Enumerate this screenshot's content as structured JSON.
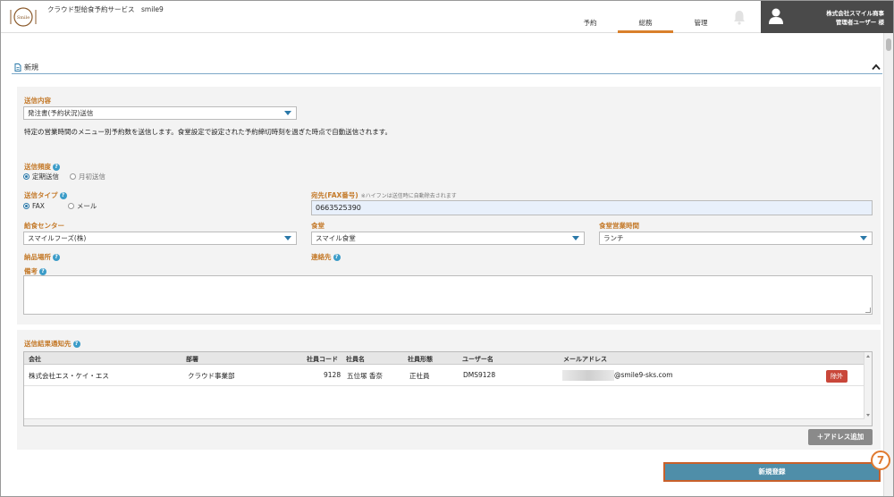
{
  "header": {
    "app_title": "クラウド型給食予約サービス　smile9",
    "logo_text": "Smile",
    "nav": [
      {
        "label": "予約",
        "active": false
      },
      {
        "label": "総務",
        "active": true
      },
      {
        "label": "管理",
        "active": false
      }
    ],
    "user": {
      "company": "株式会社スマイル商事",
      "role": "管理者ユーザー 様"
    }
  },
  "section": {
    "title": "新規"
  },
  "form": {
    "send_content": {
      "label": "送信内容",
      "value": "発注書(予約状況)送信"
    },
    "description": "特定の営業時間のメニュー別予約数を送信します。食堂設定で設定された予約締切時刻を過ぎた時点で自動送信されます。",
    "frequency": {
      "label": "送信頻度",
      "help": "?",
      "options": [
        {
          "label": "定期送信",
          "checked": true
        },
        {
          "label": "月初送信",
          "checked": false
        }
      ]
    },
    "send_type": {
      "label": "送信タイプ",
      "help": "?",
      "options": [
        {
          "label": "FAX",
          "checked": true
        },
        {
          "label": "メール",
          "checked": false
        }
      ]
    },
    "destination": {
      "label": "宛先(FAX番号)",
      "note": "※ハイフンは送信時に自動除去されます",
      "value": "0663525390"
    },
    "center": {
      "label": "給食センター",
      "value": "スマイルフーズ(株)"
    },
    "cafeteria": {
      "label": "食堂",
      "value": "スマイル食堂"
    },
    "hours": {
      "label": "食堂営業時間",
      "value": "ランチ"
    },
    "delivery_place": {
      "label": "納品場所",
      "help": "?"
    },
    "contact": {
      "label": "連絡先",
      "help": "?"
    },
    "remarks": {
      "label": "備考",
      "help": "?"
    }
  },
  "notify": {
    "label": "送信結果通知先",
    "help": "?",
    "columns": [
      "会社",
      "部署",
      "社員コード",
      "社員名",
      "社員形態",
      "ユーザー名",
      "メールアドレス"
    ],
    "rows": [
      {
        "company": "株式会社エス・ケイ・エス",
        "dept": "クラウド事業部",
        "code": "9128",
        "name": "五位塚 香奈",
        "type": "正社員",
        "username": "DMS9128",
        "email": "@smile9-sks.com",
        "remove_label": "除外"
      }
    ],
    "add_label": "＋アドレス追加"
  },
  "actions": {
    "register_label": "新規登録",
    "step_marker": "7"
  },
  "colors": {
    "accent_label": "#c47a2a",
    "primary_button": "#4f8ea9",
    "danger": "#c9473a",
    "step": "#e07a30"
  }
}
